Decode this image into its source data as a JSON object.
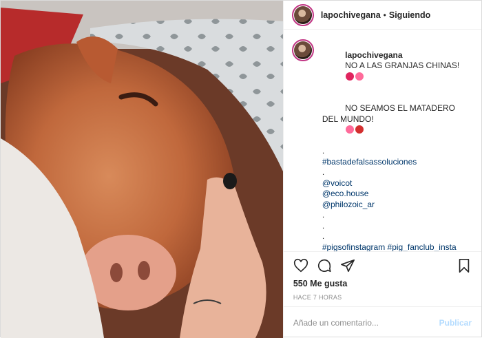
{
  "header": {
    "username": "lapochivegana",
    "separator": "•",
    "follow_label": "Siguiendo",
    "more_label": "···"
  },
  "caption": {
    "username": "lapochivegana",
    "line1": "NO A LAS GRANJAS CHINAS!",
    "line2": "NO SEAMOS EL MATADERO DEL MUNDO!",
    "dot1": ".",
    "tag1": "#bastadefalsassoluciones",
    "dot2": ".",
    "mention1": "@voicot",
    "mention2": "@eco.house",
    "mention3": "@philozoic_ar",
    "dot3": ".",
    "dot4": ".",
    "dot5": ".",
    "hashtags": "#pigsofinstagram #pig_fanclub_insta #pig_daily_insta #pigsaspet #minipigsofinstagram #minipiglove #instapig #piglover #piglife #happypig #oink #babypig #love #pet #friends #cute #minipigsargentina #vegana #minipigs #pigs #instapig",
    "emoji_colors": [
      "#e0245e",
      "#ff6b9a",
      "#d32f2f"
    ]
  },
  "actions": {
    "like_icon": "heart-icon",
    "comment_icon": "comment-icon",
    "share_icon": "paper-plane-icon",
    "save_icon": "bookmark-icon"
  },
  "likes": "550 Me gusta",
  "time": "HACE 7 HORAS",
  "comment_box": {
    "placeholder": "Añade un comentario...",
    "publish_label": "Publicar"
  },
  "colors": {
    "link": "#00376b",
    "publish": "#b3dbff",
    "muted": "#8e8e8e"
  }
}
